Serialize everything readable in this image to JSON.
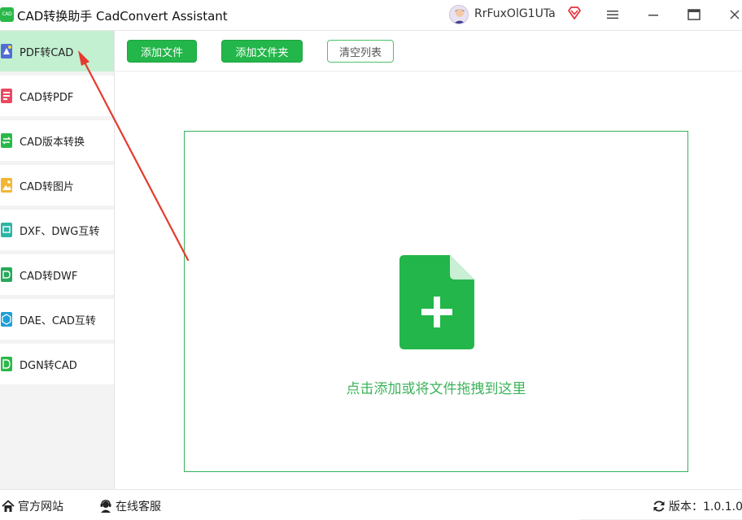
{
  "window": {
    "title": "CAD转换助手 CadConvert Assistant",
    "logo_text": "CAD",
    "user_name": "RrFuxOlG1UTa",
    "icons": {
      "avatar": "user-avatar",
      "vip": "vip-diamond-icon",
      "menu": "hamburger-menu-icon",
      "minimize": "minimize-icon",
      "maximize": "maximize-icon",
      "close": "close-icon"
    }
  },
  "sidebar": {
    "items": [
      {
        "label": "PDF转CAD",
        "active": true
      },
      {
        "label": "CAD转PDF",
        "active": false
      },
      {
        "label": "CAD版本转换",
        "active": false
      },
      {
        "label": "CAD转图片",
        "active": false
      },
      {
        "label": "DXF、DWG互转",
        "active": false
      },
      {
        "label": "CAD转DWF",
        "active": false
      },
      {
        "label": "DAE、CAD互转",
        "active": false
      },
      {
        "label": "DGN转CAD",
        "active": false
      }
    ]
  },
  "toolbar": {
    "add_file": "添加文件",
    "add_folder": "添加文件夹",
    "clear_list": "清空列表"
  },
  "dropzone": {
    "hint": "点击添加或将文件拖拽到这里",
    "icon": "add-file-icon"
  },
  "footer": {
    "official_site": "官方网站",
    "online_service": "在线客服",
    "version": "版本：1.0.1.0"
  },
  "colors": {
    "accent": "#23b64a",
    "active_item_bg": "#c3f0d1",
    "drop_text": "#3cb35a",
    "annotation_arrow": "#e53a2e"
  }
}
